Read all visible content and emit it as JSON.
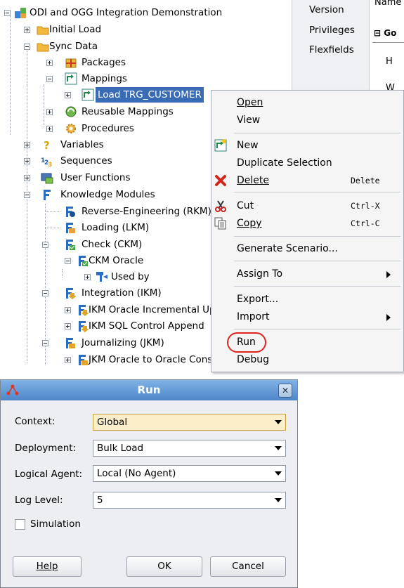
{
  "tree": {
    "root": "ODI and OGG Integration Demonstration",
    "initial_load": "Initial Load",
    "sync_data": "Sync Data",
    "packages": "Packages",
    "mappings": "Mappings",
    "load_trg": "Load TRG_CUSTOMER",
    "reusable_mappings": "Reusable Mappings",
    "procedures": "Procedures",
    "variables": "Variables",
    "sequences": "Sequences",
    "user_functions": "User Functions",
    "knowledge_modules": "Knowledge Modules",
    "rkm": "Reverse-Engineering (RKM)",
    "lkm": "Loading (LKM)",
    "ckm": "Check (CKM)",
    "ckm_oracle": "CKM Oracle",
    "used_by": "Used by",
    "ikm": "Integration (IKM)",
    "ikm_incr": "IKM Oracle Incremental Update",
    "ikm_sql": "IKM SQL Control Append",
    "jkm": "Journalizing (JKM)",
    "jkm_oracle": "JKM Oracle to Oracle Consistent"
  },
  "props": {
    "name": "Name",
    "version": "Version",
    "privileges": "Privileges",
    "flexfields": "Flexfields",
    "go": "Go",
    "h": "H",
    "w": "W"
  },
  "context_menu": {
    "open": "Open",
    "view": "View",
    "new": "New",
    "duplicate": "Duplicate Selection",
    "delete": "Delete",
    "delete_key": "Delete",
    "cut": "Cut",
    "cut_key": "Ctrl-X",
    "copy": "Copy",
    "copy_key": "Ctrl-C",
    "generate": "Generate Scenario...",
    "assign_to": "Assign To",
    "export": "Export...",
    "import": "Import",
    "run": "Run",
    "debug": "Debug"
  },
  "dialog": {
    "title": "Run",
    "context_label": "Context:",
    "context_value": "Global",
    "deployment_label": "Deployment:",
    "deployment_value": "Bulk Load",
    "agent_label": "Logical Agent:",
    "agent_value": "Local (No Agent)",
    "loglevel_label": "Log Level:",
    "loglevel_value": "5",
    "simulation_label": "Simulation",
    "help": "Help",
    "ok": "OK",
    "cancel": "Cancel"
  },
  "colors": {
    "selection": "#3a6bb5",
    "run_highlight": "#e0231e",
    "title_bar": "#4e86c8"
  }
}
